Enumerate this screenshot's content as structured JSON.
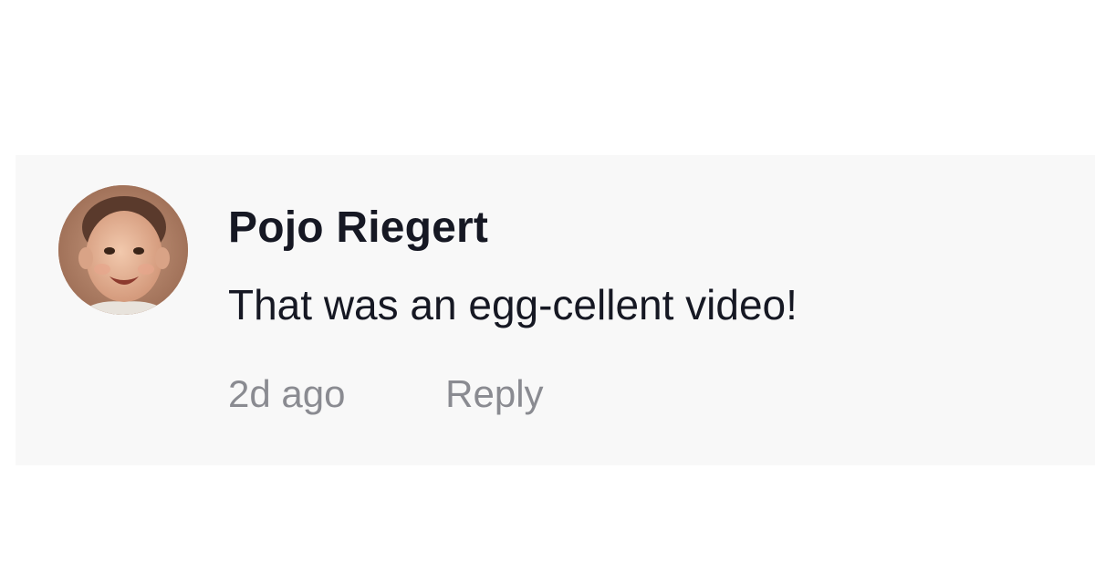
{
  "comment": {
    "author": "Pojo Riegert",
    "text": "That was an egg-cellent video!",
    "timestamp": "2d ago",
    "reply_label": "Reply",
    "avatar_icon": "baby-photo-avatar"
  },
  "colors": {
    "card_background": "#f8f8f8",
    "author_text": "#161823",
    "meta_text": "#8a8b91"
  }
}
